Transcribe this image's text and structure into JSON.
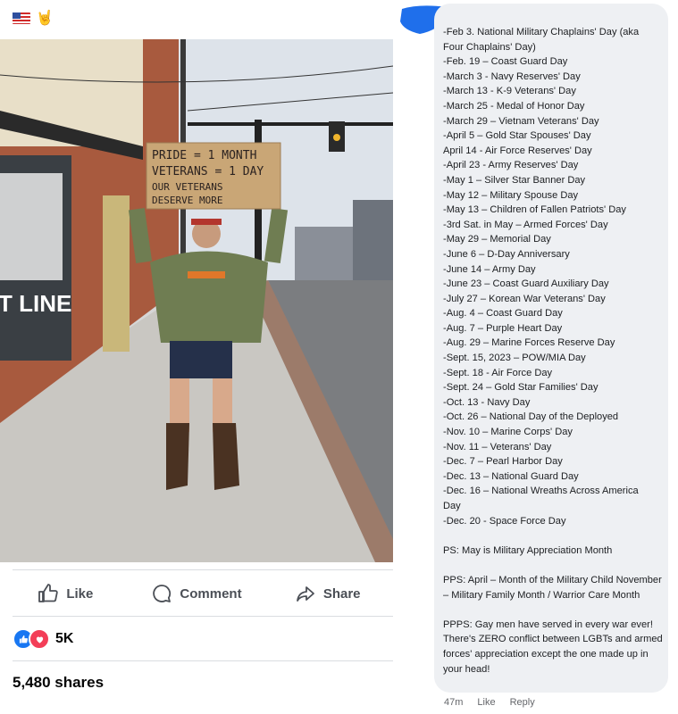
{
  "post": {
    "header_icons": [
      "us-flag-icon",
      "rock-hand-icon"
    ],
    "rock_glyph": "🤘",
    "photo": {
      "sign_lines": [
        "PRIDE = 1 MONTH",
        "VETERANS = 1 DAY",
        "OUR VETERANS",
        "DESERVE MORE"
      ],
      "window_text": "T LINE"
    },
    "actions": {
      "like": "Like",
      "comment": "Comment",
      "share": "Share"
    },
    "reactions": {
      "count": "5K",
      "types": [
        "like",
        "love"
      ]
    },
    "shares": "5,480 shares"
  },
  "comment": {
    "lines": [
      "-Feb 3. National Military Chaplains' Day (aka",
      "Four Chaplains' Day)",
      "-Feb. 19 – Coast Guard Day",
      "-March 3 - Navy Reserves' Day",
      "-March 13 - K-9 Veterans' Day",
      "-March 25 - Medal of Honor Day",
      "-March 29 – Vietnam Veterans' Day",
      "-April 5 – Gold Star Spouses' Day",
      "April 14 - Air Force Reserves' Day",
      "-April 23 - Army Reserves' Day",
      "-May 1 – Silver Star Banner Day",
      "-May 12 – Military Spouse Day",
      "-May 13 – Children of Fallen Patriots' Day",
      "-3rd Sat. in May – Armed Forces' Day",
      "-May 29 – Memorial Day",
      "-June 6 – D-Day Anniversary",
      "-June 14 – Army Day",
      "-June 23 – Coast Guard Auxiliary Day",
      "-July 27 – Korean War Veterans' Day",
      "-Aug. 4 – Coast Guard Day",
      "-Aug. 7 – Purple Heart Day",
      "-Aug. 29 – Marine Forces Reserve Day",
      "-Sept. 15, 2023 – POW/MIA Day",
      "-Sept. 18 - Air Force Day",
      "-Sept. 24 – Gold Star Families' Day",
      "-Oct. 13 - Navy Day",
      "-Oct. 26 – National Day of the Deployed",
      "-Nov. 10 – Marine Corps' Day",
      "-Nov. 11 – Veterans' Day",
      "-Dec. 7 – Pearl Harbor Day",
      "-Dec. 13 – National Guard Day",
      "-Dec. 16 – National Wreaths Across America",
      "Day",
      "-Dec. 20 - Space Force Day"
    ],
    "ps": "PS: May is Military Appreciation Month",
    "pps": "PPS: April – Month of the Military Child November – Military Family Month / Warrior Care Month",
    "ppps": "PPPS: Gay men have served in every war ever! There's ZERO conflict between LGBTs and armed forces' appreciation except the one made up in your head!",
    "meta": {
      "time": "47m",
      "like": "Like",
      "reply": "Reply"
    },
    "redaction_color": "#1f6feb"
  }
}
